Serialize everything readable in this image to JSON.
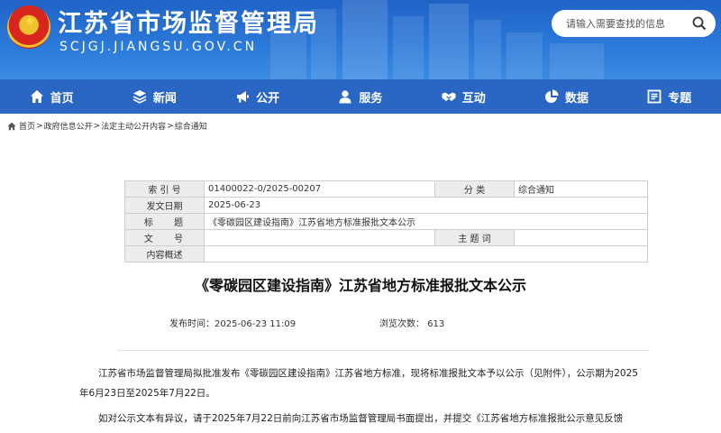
{
  "header": {
    "site_title": "江苏省市场监督管理局",
    "site_domain": "SCJGJ.JIANGSU.GOV.CN",
    "search_placeholder": "请输入需要查找的信息"
  },
  "nav": {
    "items": [
      {
        "label": "首页",
        "icon": "home-icon"
      },
      {
        "label": "新闻",
        "icon": "layers-icon"
      },
      {
        "label": "公开",
        "icon": "megaphone-icon"
      },
      {
        "label": "服务",
        "icon": "user-service-icon"
      },
      {
        "label": "互动",
        "icon": "handshake-icon"
      },
      {
        "label": "数据",
        "icon": "pie-chart-icon"
      },
      {
        "label": "专题",
        "icon": "topic-icon"
      }
    ]
  },
  "breadcrumb": {
    "items": [
      "首页",
      "政府信息公开",
      "法定主动公开内容",
      "综合通知"
    ],
    "separator": ">"
  },
  "info_table": {
    "index_label": "索 引 号",
    "index_value": "01400022-0/2025-00207",
    "category_label": "分 类",
    "category_value": "综合通知",
    "date_label": "发文日期",
    "date_value": "2025-06-23",
    "title_label": "标 题",
    "title_value": "《零碳园区建设指南》江苏省地方标准报批文本公示",
    "docno_label": "文 号",
    "docno_value": "",
    "keywords_label": "主 题 词",
    "keywords_value": "",
    "summary_label": "内容概述",
    "summary_value": ""
  },
  "article": {
    "title": "《零碳园区建设指南》江苏省地方标准报批文本公示",
    "publish_time": "发布时间：2025-06-23 11:09",
    "views": "浏览次数：  613",
    "paragraph1": "江苏省市场监督管理局拟批准发布《零碳园区建设指南》江苏省地方标准，现将标准报批文本予以公示（见附件），公示期为2025年6月23日至2025年7月22日。",
    "paragraph2": "如对公示文本有异议，请于2025年7月22日前向江苏省市场监督管理局书面提出，并提交《江苏省地方标准报批公示意见反馈"
  },
  "colors": {
    "header_blue": "#2a78d8",
    "nav_blue": "#2a66c4",
    "table_label_bg": "#ececec"
  }
}
